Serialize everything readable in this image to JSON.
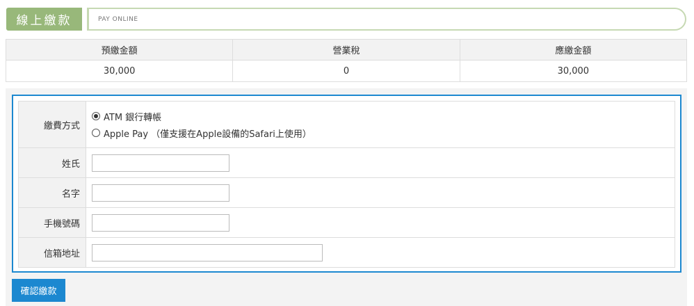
{
  "header": {
    "title": "線上繳款",
    "subtitle": "PAY ONLINE"
  },
  "summary": {
    "columns": [
      "預繳金額",
      "營業稅",
      "應繳金額"
    ],
    "values": [
      "30,000",
      "0",
      "30,000"
    ]
  },
  "form": {
    "payment_method": {
      "label": "繳費方式",
      "options": [
        {
          "label": "ATM 銀行轉帳",
          "selected": true
        },
        {
          "label": "Apple Pay （僅支援在Apple設備的Safari上使用）",
          "selected": false
        }
      ]
    },
    "last_name": {
      "label": "姓氏",
      "value": ""
    },
    "first_name": {
      "label": "名字",
      "value": ""
    },
    "mobile": {
      "label": "手機號碼",
      "value": ""
    },
    "email": {
      "label": "信箱地址",
      "value": ""
    }
  },
  "confirm_button": "確認繳款",
  "colors": {
    "title_green": "#98b87a",
    "accent_blue": "#1c88d0"
  }
}
